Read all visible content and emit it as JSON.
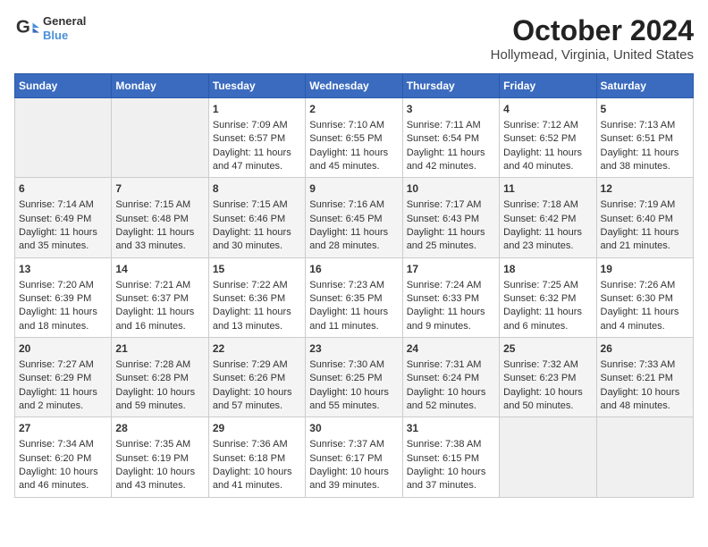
{
  "header": {
    "logo": {
      "line1": "General",
      "line2": "Blue"
    },
    "title": "October 2024",
    "subtitle": "Hollymead, Virginia, United States"
  },
  "calendar": {
    "weekdays": [
      "Sunday",
      "Monday",
      "Tuesday",
      "Wednesday",
      "Thursday",
      "Friday",
      "Saturday"
    ],
    "weeks": [
      [
        {
          "day": "",
          "empty": true
        },
        {
          "day": "",
          "empty": true
        },
        {
          "day": "1",
          "line1": "Sunrise: 7:09 AM",
          "line2": "Sunset: 6:57 PM",
          "line3": "Daylight: 11 hours",
          "line4": "and 47 minutes."
        },
        {
          "day": "2",
          "line1": "Sunrise: 7:10 AM",
          "line2": "Sunset: 6:55 PM",
          "line3": "Daylight: 11 hours",
          "line4": "and 45 minutes."
        },
        {
          "day": "3",
          "line1": "Sunrise: 7:11 AM",
          "line2": "Sunset: 6:54 PM",
          "line3": "Daylight: 11 hours",
          "line4": "and 42 minutes."
        },
        {
          "day": "4",
          "line1": "Sunrise: 7:12 AM",
          "line2": "Sunset: 6:52 PM",
          "line3": "Daylight: 11 hours",
          "line4": "and 40 minutes."
        },
        {
          "day": "5",
          "line1": "Sunrise: 7:13 AM",
          "line2": "Sunset: 6:51 PM",
          "line3": "Daylight: 11 hours",
          "line4": "and 38 minutes."
        }
      ],
      [
        {
          "day": "6",
          "line1": "Sunrise: 7:14 AM",
          "line2": "Sunset: 6:49 PM",
          "line3": "Daylight: 11 hours",
          "line4": "and 35 minutes."
        },
        {
          "day": "7",
          "line1": "Sunrise: 7:15 AM",
          "line2": "Sunset: 6:48 PM",
          "line3": "Daylight: 11 hours",
          "line4": "and 33 minutes."
        },
        {
          "day": "8",
          "line1": "Sunrise: 7:15 AM",
          "line2": "Sunset: 6:46 PM",
          "line3": "Daylight: 11 hours",
          "line4": "and 30 minutes."
        },
        {
          "day": "9",
          "line1": "Sunrise: 7:16 AM",
          "line2": "Sunset: 6:45 PM",
          "line3": "Daylight: 11 hours",
          "line4": "and 28 minutes."
        },
        {
          "day": "10",
          "line1": "Sunrise: 7:17 AM",
          "line2": "Sunset: 6:43 PM",
          "line3": "Daylight: 11 hours",
          "line4": "and 25 minutes."
        },
        {
          "day": "11",
          "line1": "Sunrise: 7:18 AM",
          "line2": "Sunset: 6:42 PM",
          "line3": "Daylight: 11 hours",
          "line4": "and 23 minutes."
        },
        {
          "day": "12",
          "line1": "Sunrise: 7:19 AM",
          "line2": "Sunset: 6:40 PM",
          "line3": "Daylight: 11 hours",
          "line4": "and 21 minutes."
        }
      ],
      [
        {
          "day": "13",
          "line1": "Sunrise: 7:20 AM",
          "line2": "Sunset: 6:39 PM",
          "line3": "Daylight: 11 hours",
          "line4": "and 18 minutes."
        },
        {
          "day": "14",
          "line1": "Sunrise: 7:21 AM",
          "line2": "Sunset: 6:37 PM",
          "line3": "Daylight: 11 hours",
          "line4": "and 16 minutes."
        },
        {
          "day": "15",
          "line1": "Sunrise: 7:22 AM",
          "line2": "Sunset: 6:36 PM",
          "line3": "Daylight: 11 hours",
          "line4": "and 13 minutes."
        },
        {
          "day": "16",
          "line1": "Sunrise: 7:23 AM",
          "line2": "Sunset: 6:35 PM",
          "line3": "Daylight: 11 hours",
          "line4": "and 11 minutes."
        },
        {
          "day": "17",
          "line1": "Sunrise: 7:24 AM",
          "line2": "Sunset: 6:33 PM",
          "line3": "Daylight: 11 hours",
          "line4": "and 9 minutes."
        },
        {
          "day": "18",
          "line1": "Sunrise: 7:25 AM",
          "line2": "Sunset: 6:32 PM",
          "line3": "Daylight: 11 hours",
          "line4": "and 6 minutes."
        },
        {
          "day": "19",
          "line1": "Sunrise: 7:26 AM",
          "line2": "Sunset: 6:30 PM",
          "line3": "Daylight: 11 hours",
          "line4": "and 4 minutes."
        }
      ],
      [
        {
          "day": "20",
          "line1": "Sunrise: 7:27 AM",
          "line2": "Sunset: 6:29 PM",
          "line3": "Daylight: 11 hours",
          "line4": "and 2 minutes."
        },
        {
          "day": "21",
          "line1": "Sunrise: 7:28 AM",
          "line2": "Sunset: 6:28 PM",
          "line3": "Daylight: 10 hours",
          "line4": "and 59 minutes."
        },
        {
          "day": "22",
          "line1": "Sunrise: 7:29 AM",
          "line2": "Sunset: 6:26 PM",
          "line3": "Daylight: 10 hours",
          "line4": "and 57 minutes."
        },
        {
          "day": "23",
          "line1": "Sunrise: 7:30 AM",
          "line2": "Sunset: 6:25 PM",
          "line3": "Daylight: 10 hours",
          "line4": "and 55 minutes."
        },
        {
          "day": "24",
          "line1": "Sunrise: 7:31 AM",
          "line2": "Sunset: 6:24 PM",
          "line3": "Daylight: 10 hours",
          "line4": "and 52 minutes."
        },
        {
          "day": "25",
          "line1": "Sunrise: 7:32 AM",
          "line2": "Sunset: 6:23 PM",
          "line3": "Daylight: 10 hours",
          "line4": "and 50 minutes."
        },
        {
          "day": "26",
          "line1": "Sunrise: 7:33 AM",
          "line2": "Sunset: 6:21 PM",
          "line3": "Daylight: 10 hours",
          "line4": "and 48 minutes."
        }
      ],
      [
        {
          "day": "27",
          "line1": "Sunrise: 7:34 AM",
          "line2": "Sunset: 6:20 PM",
          "line3": "Daylight: 10 hours",
          "line4": "and 46 minutes."
        },
        {
          "day": "28",
          "line1": "Sunrise: 7:35 AM",
          "line2": "Sunset: 6:19 PM",
          "line3": "Daylight: 10 hours",
          "line4": "and 43 minutes."
        },
        {
          "day": "29",
          "line1": "Sunrise: 7:36 AM",
          "line2": "Sunset: 6:18 PM",
          "line3": "Daylight: 10 hours",
          "line4": "and 41 minutes."
        },
        {
          "day": "30",
          "line1": "Sunrise: 7:37 AM",
          "line2": "Sunset: 6:17 PM",
          "line3": "Daylight: 10 hours",
          "line4": "and 39 minutes."
        },
        {
          "day": "31",
          "line1": "Sunrise: 7:38 AM",
          "line2": "Sunset: 6:15 PM",
          "line3": "Daylight: 10 hours",
          "line4": "and 37 minutes."
        },
        {
          "day": "",
          "empty": true
        },
        {
          "day": "",
          "empty": true
        }
      ]
    ]
  }
}
